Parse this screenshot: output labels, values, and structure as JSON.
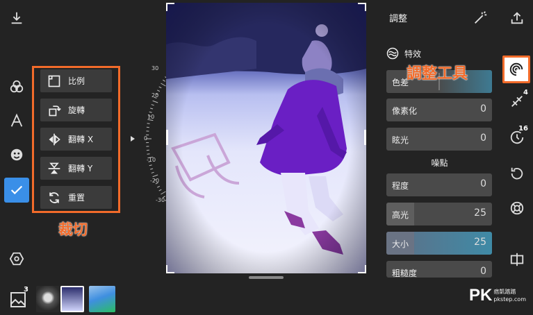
{
  "header": {
    "download_icon": "download-icon",
    "share_icon": "share-icon"
  },
  "crop": {
    "items": [
      {
        "label": "比例",
        "icon": "aspect-ratio-icon"
      },
      {
        "label": "旋轉",
        "icon": "rotate-icon"
      },
      {
        "label": "翻轉 X",
        "icon": "flip-horizontal-icon"
      },
      {
        "label": "翻轉 Y",
        "icon": "flip-vertical-icon"
      },
      {
        "label": "重置",
        "icon": "reset-icon"
      }
    ],
    "annotation": "裁切"
  },
  "dial": {
    "ticks": [
      "30",
      "20",
      "10",
      "0",
      "-10",
      "-20",
      "-30"
    ]
  },
  "adjust": {
    "title": "調整",
    "effects_label": "特效",
    "annotation": "調整工具",
    "sliders_top": [
      {
        "label": "色差",
        "value": ""
      },
      {
        "label": "像素化",
        "value": "0"
      },
      {
        "label": "眩光",
        "value": "0"
      }
    ],
    "noise_label": "噪點",
    "sliders_noise": [
      {
        "label": "程度",
        "value": "0"
      },
      {
        "label": "高光",
        "value": "25"
      },
      {
        "label": "大小",
        "value": "25"
      },
      {
        "label": "粗糙度",
        "value": "0"
      }
    ]
  },
  "right_tools": {
    "badge_heal": "4",
    "badge_history": "16"
  },
  "bottom": {
    "layers_count": "3"
  },
  "watermark": {
    "logo": "PK",
    "caption": "痞凱踏踏",
    "url": "pkstep.com"
  },
  "colors": {
    "accent": "#3a8fe8",
    "annotation": "#f26b2a"
  }
}
